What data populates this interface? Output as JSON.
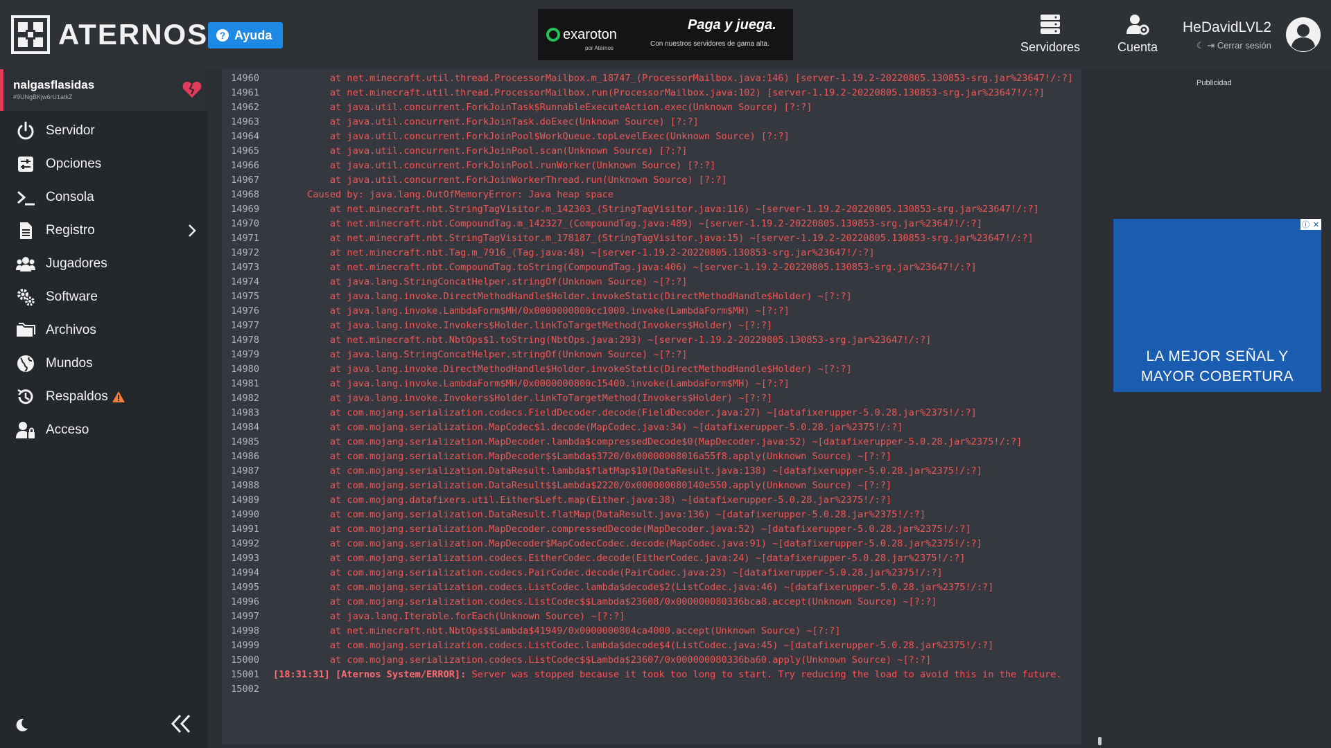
{
  "header": {
    "logo_text": "ATERNOS",
    "help_label": "Ayuda",
    "top_ad": {
      "brand": "exaroton",
      "brand_sub": "por Aternos",
      "slogan": "Paga y juega.",
      "slogan_sub": "Con nuestros servidores de gama alta."
    },
    "nav": {
      "servers": "Servidores",
      "account": "Cuenta"
    },
    "user": {
      "name": "HeDavidLVL2",
      "logout": "Cerrar sesión"
    }
  },
  "sidebar": {
    "server_name": "nalgasflasidas",
    "server_id": "#9UNgBKjw6rU1atkZ",
    "items": [
      {
        "label": "Servidor",
        "icon": "power-icon"
      },
      {
        "label": "Opciones",
        "icon": "sliders-icon"
      },
      {
        "label": "Consola",
        "icon": "terminal-icon"
      },
      {
        "label": "Registro",
        "icon": "file-icon"
      },
      {
        "label": "Jugadores",
        "icon": "users-icon"
      },
      {
        "label": "Software",
        "icon": "gears-icon"
      },
      {
        "label": "Archivos",
        "icon": "folder-icon"
      },
      {
        "label": "Mundos",
        "icon": "globe-icon"
      },
      {
        "label": "Respaldos",
        "icon": "history-icon"
      },
      {
        "label": "Acceso",
        "icon": "user-lock-icon"
      }
    ]
  },
  "ads": {
    "label": "Publicidad",
    "side_ad_line1": "LA MEJOR SEÑAL Y",
    "side_ad_line2": "MAYOR COBERTURA"
  },
  "colors": {
    "accent_blue": "#1e88e5",
    "server_accent": "#e13b5a",
    "log_red": "#f05656"
  },
  "console": {
    "lines": [
      {
        "n": "14960",
        "t": "          at net.minecraft.util.thread.ProcessorMailbox.m_18747_(ProcessorMailbox.java:146) [server-1.19.2-20220805.130853-srg.jar%23647!/:?]"
      },
      {
        "n": "14961",
        "t": "          at net.minecraft.util.thread.ProcessorMailbox.run(ProcessorMailbox.java:102) [server-1.19.2-20220805.130853-srg.jar%23647!/:?]"
      },
      {
        "n": "14962",
        "t": "          at java.util.concurrent.ForkJoinTask$RunnableExecuteAction.exec(Unknown Source) [?:?]"
      },
      {
        "n": "14963",
        "t": "          at java.util.concurrent.ForkJoinTask.doExec(Unknown Source) [?:?]"
      },
      {
        "n": "14964",
        "t": "          at java.util.concurrent.ForkJoinPool$WorkQueue.topLevelExec(Unknown Source) [?:?]"
      },
      {
        "n": "14965",
        "t": "          at java.util.concurrent.ForkJoinPool.scan(Unknown Source) [?:?]"
      },
      {
        "n": "14966",
        "t": "          at java.util.concurrent.ForkJoinPool.runWorker(Unknown Source) [?:?]"
      },
      {
        "n": "14967",
        "t": "          at java.util.concurrent.ForkJoinWorkerThread.run(Unknown Source) [?:?]"
      },
      {
        "n": "14968",
        "t": "      Caused by: java.lang.OutOfMemoryError: Java heap space"
      },
      {
        "n": "14969",
        "t": "          at net.minecraft.nbt.StringTagVisitor.m_142303_(StringTagVisitor.java:116) ~[server-1.19.2-20220805.130853-srg.jar%23647!/:?]"
      },
      {
        "n": "14970",
        "t": "          at net.minecraft.nbt.CompoundTag.m_142327_(CompoundTag.java:489) ~[server-1.19.2-20220805.130853-srg.jar%23647!/:?]"
      },
      {
        "n": "14971",
        "t": "          at net.minecraft.nbt.StringTagVisitor.m_178187_(StringTagVisitor.java:15) ~[server-1.19.2-20220805.130853-srg.jar%23647!/:?]"
      },
      {
        "n": "14972",
        "t": "          at net.minecraft.nbt.Tag.m_7916_(Tag.java:48) ~[server-1.19.2-20220805.130853-srg.jar%23647!/:?]"
      },
      {
        "n": "14973",
        "t": "          at net.minecraft.nbt.CompoundTag.toString(CompoundTag.java:406) ~[server-1.19.2-20220805.130853-srg.jar%23647!/:?]"
      },
      {
        "n": "14974",
        "t": "          at java.lang.StringConcatHelper.stringOf(Unknown Source) ~[?:?]"
      },
      {
        "n": "14975",
        "t": "          at java.lang.invoke.DirectMethodHandle$Holder.invokeStatic(DirectMethodHandle$Holder) ~[?:?]"
      },
      {
        "n": "14976",
        "t": "          at java.lang.invoke.LambdaForm$MH/0x0000000800cc1000.invoke(LambdaForm$MH) ~[?:?]"
      },
      {
        "n": "14977",
        "t": "          at java.lang.invoke.Invokers$Holder.linkToTargetMethod(Invokers$Holder) ~[?:?]"
      },
      {
        "n": "14978",
        "t": "          at net.minecraft.nbt.NbtOps$1.toString(NbtOps.java:293) ~[server-1.19.2-20220805.130853-srg.jar%23647!/:?]"
      },
      {
        "n": "14979",
        "t": "          at java.lang.StringConcatHelper.stringOf(Unknown Source) ~[?:?]"
      },
      {
        "n": "14980",
        "t": "          at java.lang.invoke.DirectMethodHandle$Holder.invokeStatic(DirectMethodHandle$Holder) ~[?:?]"
      },
      {
        "n": "14981",
        "t": "          at java.lang.invoke.LambdaForm$MH/0x0000000800c15400.invoke(LambdaForm$MH) ~[?:?]"
      },
      {
        "n": "14982",
        "t": "          at java.lang.invoke.Invokers$Holder.linkToTargetMethod(Invokers$Holder) ~[?:?]"
      },
      {
        "n": "14983",
        "t": "          at com.mojang.serialization.codecs.FieldDecoder.decode(FieldDecoder.java:27) ~[datafixerupper-5.0.28.jar%2375!/:?]"
      },
      {
        "n": "14984",
        "t": "          at com.mojang.serialization.MapCodec$1.decode(MapCodec.java:34) ~[datafixerupper-5.0.28.jar%2375!/:?]"
      },
      {
        "n": "14985",
        "t": "          at com.mojang.serialization.MapDecoder.lambda$compressedDecode$0(MapDecoder.java:52) ~[datafixerupper-5.0.28.jar%2375!/:?]"
      },
      {
        "n": "14986",
        "t": "          at com.mojang.serialization.MapDecoder$$Lambda$3720/0x00000008016a55f8.apply(Unknown Source) ~[?:?]"
      },
      {
        "n": "14987",
        "t": "          at com.mojang.serialization.DataResult.lambda$flatMap$10(DataResult.java:138) ~[datafixerupper-5.0.28.jar%2375!/:?]"
      },
      {
        "n": "14988",
        "t": "          at com.mojang.serialization.DataResult$$Lambda$2220/0x000000080140e550.apply(Unknown Source) ~[?:?]"
      },
      {
        "n": "14989",
        "t": "          at com.mojang.datafixers.util.Either$Left.map(Either.java:38) ~[datafixerupper-5.0.28.jar%2375!/:?]"
      },
      {
        "n": "14990",
        "t": "          at com.mojang.serialization.DataResult.flatMap(DataResult.java:136) ~[datafixerupper-5.0.28.jar%2375!/:?]"
      },
      {
        "n": "14991",
        "t": "          at com.mojang.serialization.MapDecoder.compressedDecode(MapDecoder.java:52) ~[datafixerupper-5.0.28.jar%2375!/:?]"
      },
      {
        "n": "14992",
        "t": "          at com.mojang.serialization.MapDecoder$MapCodecCodec.decode(MapCodec.java:91) ~[datafixerupper-5.0.28.jar%2375!/:?]"
      },
      {
        "n": "14993",
        "t": "          at com.mojang.serialization.codecs.EitherCodec.decode(EitherCodec.java:24) ~[datafixerupper-5.0.28.jar%2375!/:?]"
      },
      {
        "n": "14994",
        "t": "          at com.mojang.serialization.codecs.PairCodec.decode(PairCodec.java:23) ~[datafixerupper-5.0.28.jar%2375!/:?]"
      },
      {
        "n": "14995",
        "t": "          at com.mojang.serialization.codecs.ListCodec.lambda$decode$2(ListCodec.java:46) ~[datafixerupper-5.0.28.jar%2375!/:?]"
      },
      {
        "n": "14996",
        "t": "          at com.mojang.serialization.codecs.ListCodec$$Lambda$23608/0x000000080336bca8.accept(Unknown Source) ~[?:?]"
      },
      {
        "n": "14997",
        "t": "          at java.lang.Iterable.forEach(Unknown Source) ~[?:?]"
      },
      {
        "n": "14998",
        "t": "          at net.minecraft.nbt.NbtOps$$Lambda$41949/0x0000000804ca4000.accept(Unknown Source) ~[?:?]"
      },
      {
        "n": "14999",
        "t": "          at com.mojang.serialization.codecs.ListCodec.lambda$decode$4(ListCodec.java:45) ~[datafixerupper-5.0.28.jar%2375!/:?]"
      },
      {
        "n": "15000",
        "t": "          at com.mojang.serialization.codecs.ListCodec$$Lambda$23607/0x000000080336ba60.apply(Unknown Source) ~[?:?]"
      }
    ],
    "error_line": {
      "n": "15001",
      "prefix": "[18:31:31] [Aternos System/ERROR]:",
      "t": " Server was stopped because it took too long to start. Try reducing the load to avoid this in the future."
    },
    "last_line_number": "15002"
  }
}
